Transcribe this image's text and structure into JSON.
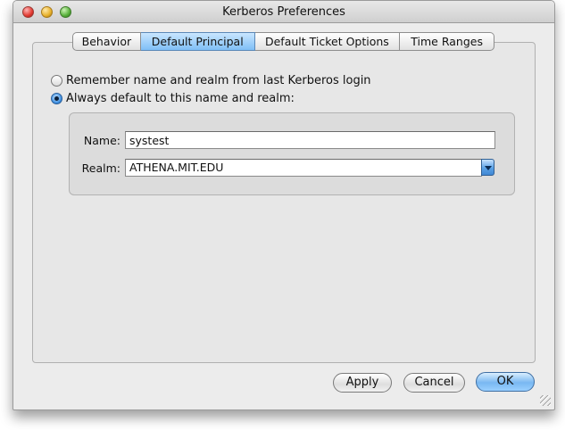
{
  "window": {
    "title": "Kerberos Preferences"
  },
  "tabs": [
    {
      "label": "Behavior",
      "selected": false
    },
    {
      "label": "Default Principal",
      "selected": true
    },
    {
      "label": "Default Ticket Options",
      "selected": false
    },
    {
      "label": "Time Ranges",
      "selected": false
    }
  ],
  "radios": [
    {
      "label": "Remember name and realm from last Kerberos login",
      "checked": false
    },
    {
      "label": "Always default to this name and realm:",
      "checked": true
    }
  ],
  "fields": {
    "name_label": "Name:",
    "name_value": "systest",
    "realm_label": "Realm:",
    "realm_value": "ATHENA.MIT.EDU"
  },
  "buttons": {
    "apply": "Apply",
    "cancel": "Cancel",
    "ok": "OK"
  },
  "colors": {
    "accent": "#5ba2e6",
    "window_bg": "#ececec"
  }
}
